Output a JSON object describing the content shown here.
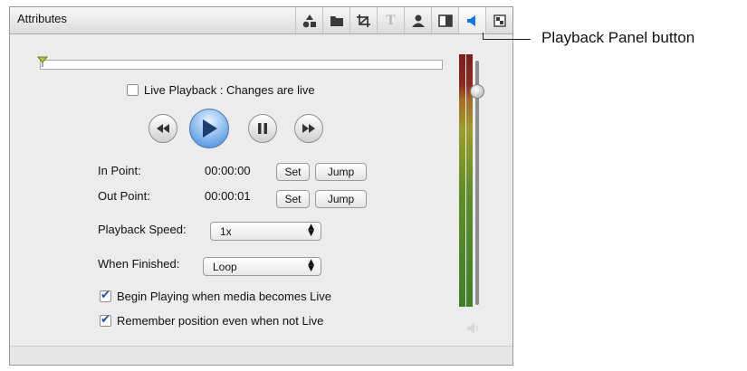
{
  "panel": {
    "title": "Attributes",
    "tabs": [
      {
        "icon": "shapes-icon",
        "active": false
      },
      {
        "icon": "folder-icon",
        "active": false
      },
      {
        "icon": "crop-icon",
        "active": false
      },
      {
        "icon": "text-icon",
        "label": "T",
        "active": false
      },
      {
        "icon": "person-icon",
        "active": false
      },
      {
        "icon": "split-panel-icon",
        "active": false
      },
      {
        "icon": "speaker-icon",
        "active": true
      },
      {
        "icon": "checker-icon",
        "active": false
      }
    ]
  },
  "playback": {
    "live_playback_label": "Live Playback : Changes are live",
    "live_playback_checked": false,
    "transport": [
      "rewind-icon",
      "play-icon",
      "pause-icon",
      "fast-forward-icon"
    ],
    "in_point_label": "In Point:",
    "in_point_value": "00:00:00",
    "out_point_label": "Out Point:",
    "out_point_value": "00:00:01",
    "set_label": "Set",
    "jump_label": "Jump",
    "speed_label": "Playback Speed:",
    "speed_value": "1x",
    "finished_label": "When Finished:",
    "finished_value": "Loop",
    "begin_playing_label": "Begin Playing when media becomes Live",
    "begin_playing_checked": true,
    "remember_position_label": "Remember position even when not Live",
    "remember_position_checked": true
  },
  "colors": {
    "active_tab_icon": "#1a73e8",
    "play_button": "#3f7fc9",
    "checkmark": "#1e4f9e"
  },
  "callout": {
    "text": "Playback Panel button"
  }
}
